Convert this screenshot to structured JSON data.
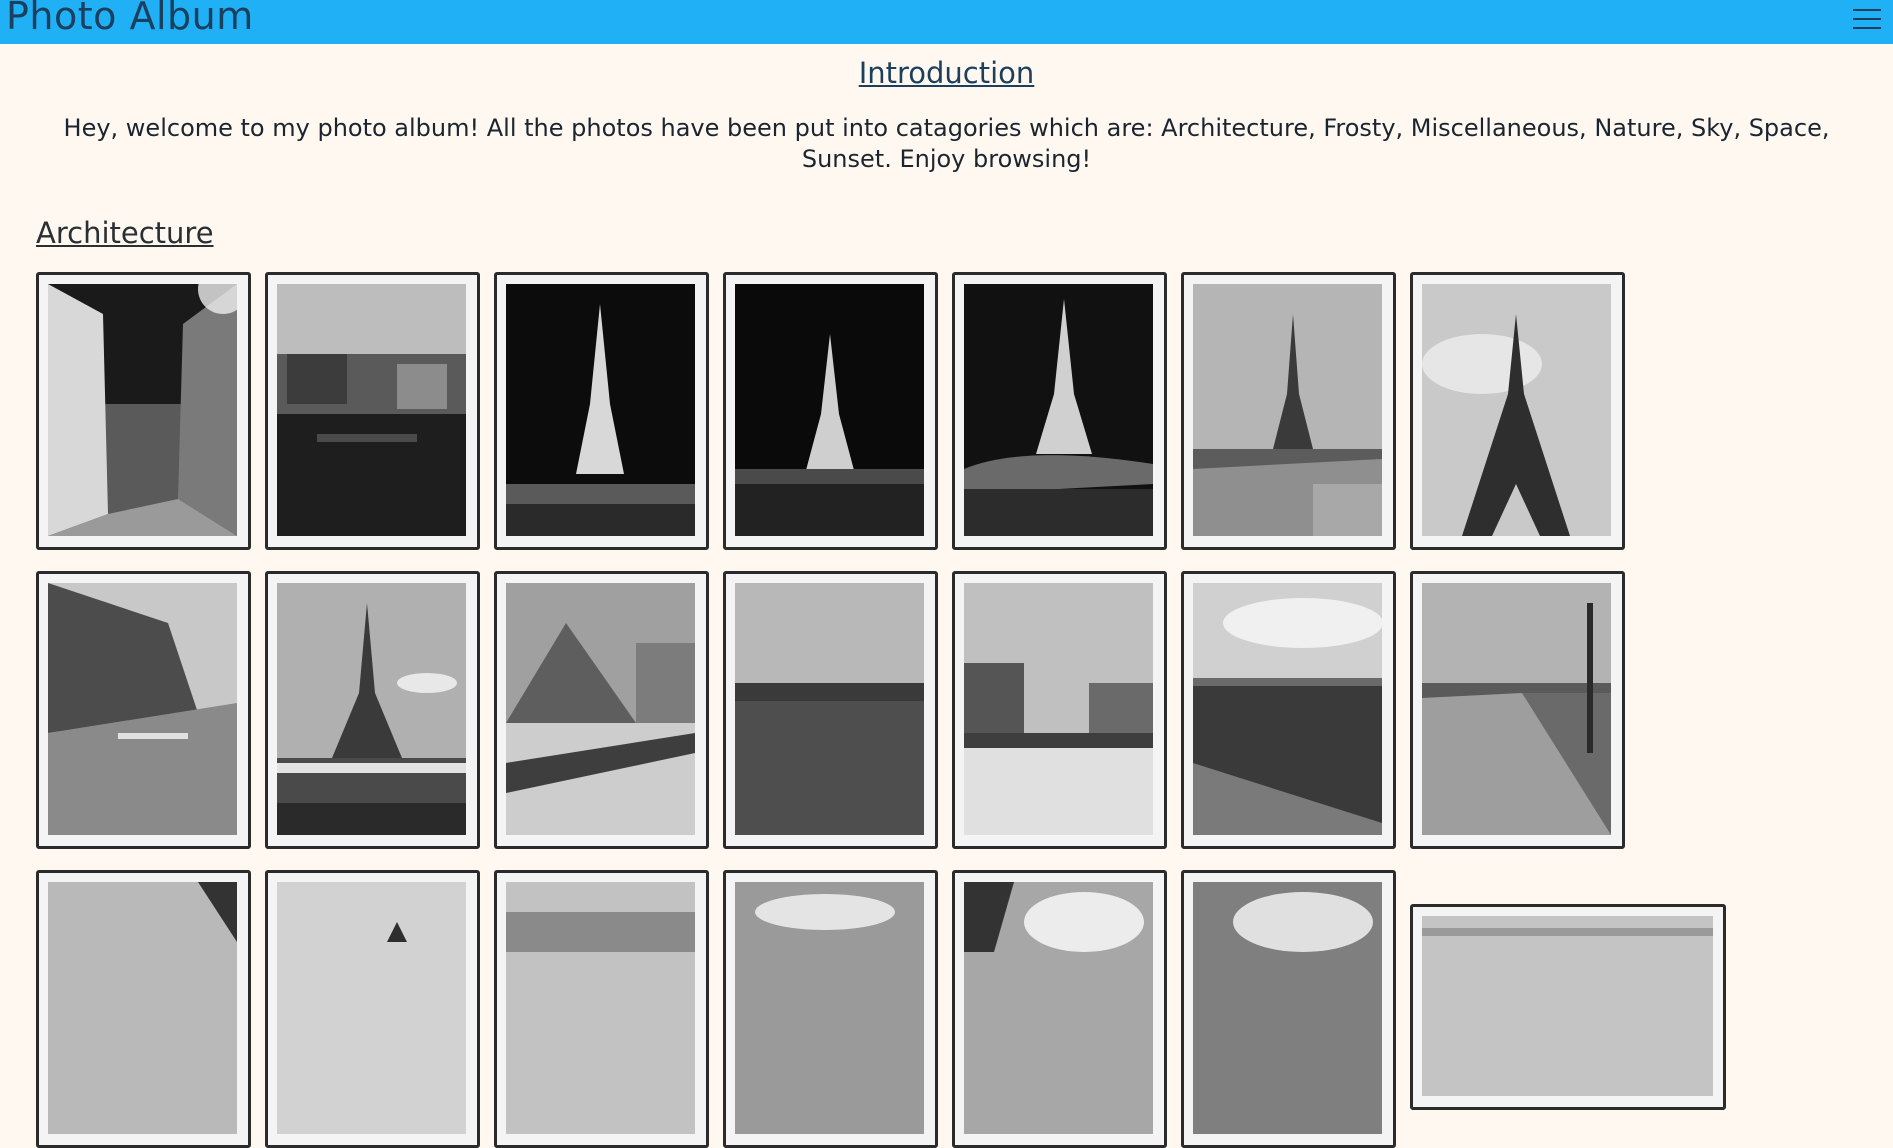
{
  "header": {
    "title": "Photo Album",
    "menu_icon": "hamburger-menu-icon",
    "background_color": "#1fb0f5"
  },
  "intro": {
    "heading": "Introduction",
    "text": "Hey, welcome to my photo album! All the photos have been put into catagories which are: Architecture, Frosty, Miscellaneous, Nature, Sky, Space, Sunset. Enjoy browsing!"
  },
  "sections": [
    {
      "heading": "Architecture",
      "photos": [
        "street-alley-photo",
        "river-buildings-photo",
        "eiffel-tower-night-photo",
        "eiffel-tower-night-river-photo",
        "eiffel-tower-night-bridge-photo",
        "eiffel-tower-plaza-photo",
        "eiffel-tower-closeup-photo",
        "paris-street-photo",
        "eiffel-tower-riverboat-photo",
        "louvre-pyramid-photo",
        "seine-river-photo",
        "louvre-garden-photo",
        "river-embankment-photo",
        "harbor-promenade-photo",
        "cloudy-building-photo",
        "church-spire-photo",
        "city-skyline-photo",
        "cloudy-sky-photo",
        "tower-clouds-photo",
        "clouds-photo",
        "panorama-photo"
      ]
    }
  ],
  "page_background_color": "#fff8f0"
}
